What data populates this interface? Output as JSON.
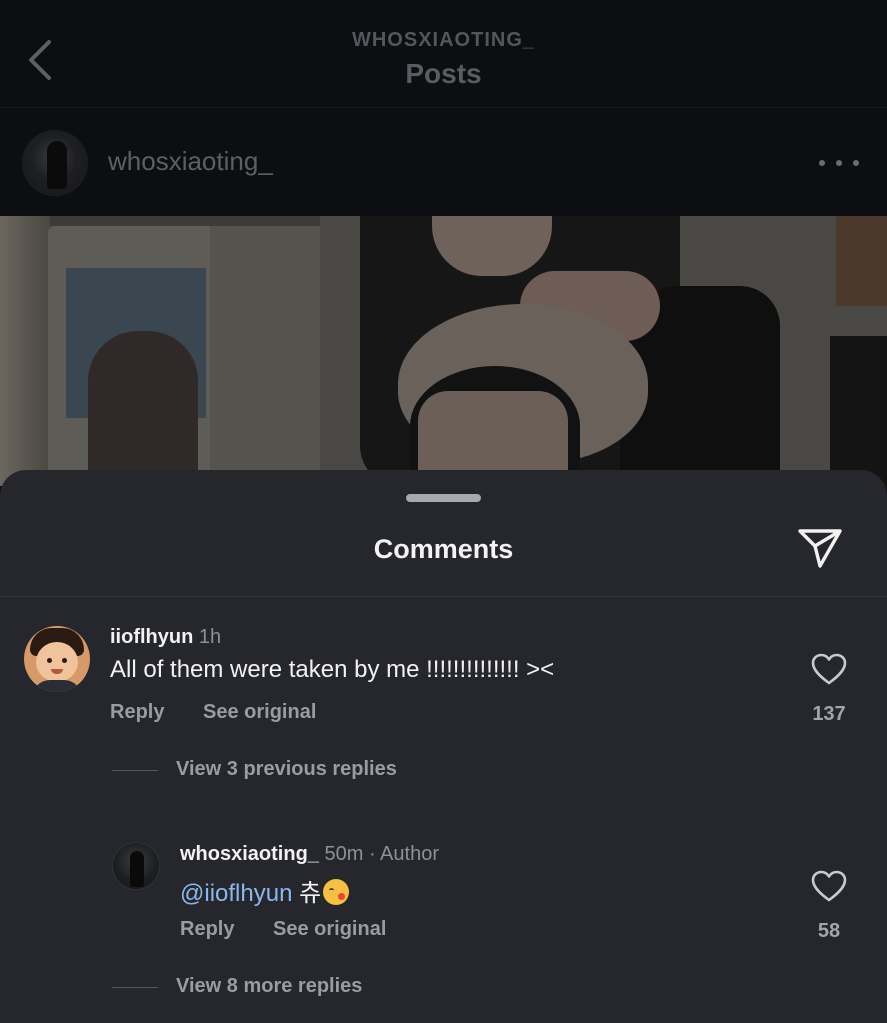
{
  "header": {
    "username": "WHOSXIAOTING_",
    "title": "Posts"
  },
  "post": {
    "username": "whosxiaoting_"
  },
  "comments_sheet": {
    "title": "Comments",
    "comments": [
      {
        "username": "iioflhyun",
        "time": "1h",
        "text": "All of them were taken by me !!!!!!!!!!!!!! ><",
        "reply_label": "Reply",
        "see_original_label": "See original",
        "likes": "137",
        "view_replies_label": "View 3 previous replies"
      },
      {
        "username": "whosxiaoting_",
        "time": "50m",
        "author_label": "· Author",
        "mention": "@iioflhyun",
        "text": "츄",
        "reply_label": "Reply",
        "see_original_label": "See original",
        "likes": "58",
        "view_replies_label": "View 8 more replies"
      }
    ]
  },
  "icons": {
    "back": "chevron-left-icon",
    "more": "more-horizontal-icon",
    "share": "paper-plane-icon",
    "like": "heart-outline-icon",
    "emoji": "kissing-face-emoji"
  }
}
